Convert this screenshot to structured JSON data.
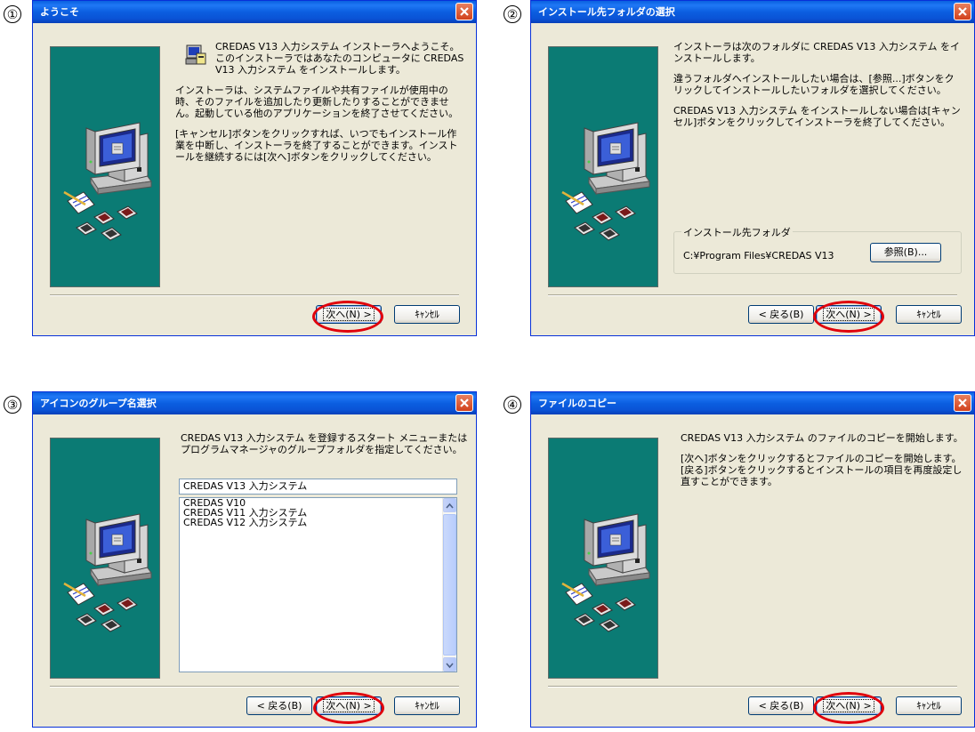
{
  "steps": [
    {
      "number": "①",
      "title": "ようこそ",
      "intro": "CREDAS V13 入力システム インストーラへようこそ。このインストーラではあなたのコンピュータに CREDAS V13 入力システム をインストールします。",
      "para2": "インストーラは、システムファイルや共有ファイルが使用中の時、そのファイルを追加したり更新したりすることができません。起動している他のアプリケーションを終了させてください。",
      "para3": "[キャンセル]ボタンをクリックすれば、いつでもインストール作業を中断し、インストーラを終了することができます。インストールを継続するには[次へ]ボタンをクリックしてください。",
      "next_label": "次へ(N) >",
      "cancel_label": "ｷｬﾝｾﾙ"
    },
    {
      "number": "②",
      "title": "インストール先フォルダの選択",
      "para1": "インストーラは次のフォルダに CREDAS V13 入力システム をインストールします。",
      "para2": "違うフォルダへインストールしたい場合は、[参照...]ボタンをクリックしてインストールしたいフォルダを選択してください。",
      "para3": "CREDAS V13 入力システム をインストールしない場合は[キャンセル]ボタンをクリックしてインストーラを終了してください。",
      "folder_legend": "インストール先フォルダ",
      "folder_path": "C:¥Program Files¥CREDAS V13",
      "browse_label": "参照(B)...",
      "back_label": "< 戻る(B)",
      "next_label": "次へ(N) >",
      "cancel_label": "ｷｬﾝｾﾙ"
    },
    {
      "number": "③",
      "title": "アイコンのグループ名選択",
      "para1": "CREDAS V13 入力システム を登録するスタート メニューまたはプログラムマネージャのグループフォルダを指定してください。",
      "group_value": "CREDAS V13 入力システム",
      "group_items": [
        "CREDAS V10",
        "CREDAS V11 入力システム",
        "CREDAS V12 入力システム"
      ],
      "back_label": "< 戻る(B)",
      "next_label": "次へ(N) >",
      "cancel_label": "ｷｬﾝｾﾙ"
    },
    {
      "number": "④",
      "title": "ファイルのコピー",
      "para1": "CREDAS V13 入力システム のファイルのコピーを開始します。",
      "para2": "[次へ]ボタンをクリックするとファイルのコピーを開始します。[戻る]ボタンをクリックするとインストールの項目を再度設定し直すことができます。",
      "back_label": "< 戻る(B)",
      "next_label": "次へ(N) >",
      "cancel_label": "ｷｬﾝｾﾙ"
    }
  ],
  "colors": {
    "titlebar": "#0a5fe0",
    "dialog_bg": "#ece9d8",
    "side_panel": "#0b7b74",
    "highlight": "#e0000b"
  },
  "icons": [
    "computer-illustration-icon",
    "installer-icon",
    "close-icon",
    "scroll-up-icon",
    "scroll-down-icon"
  ]
}
